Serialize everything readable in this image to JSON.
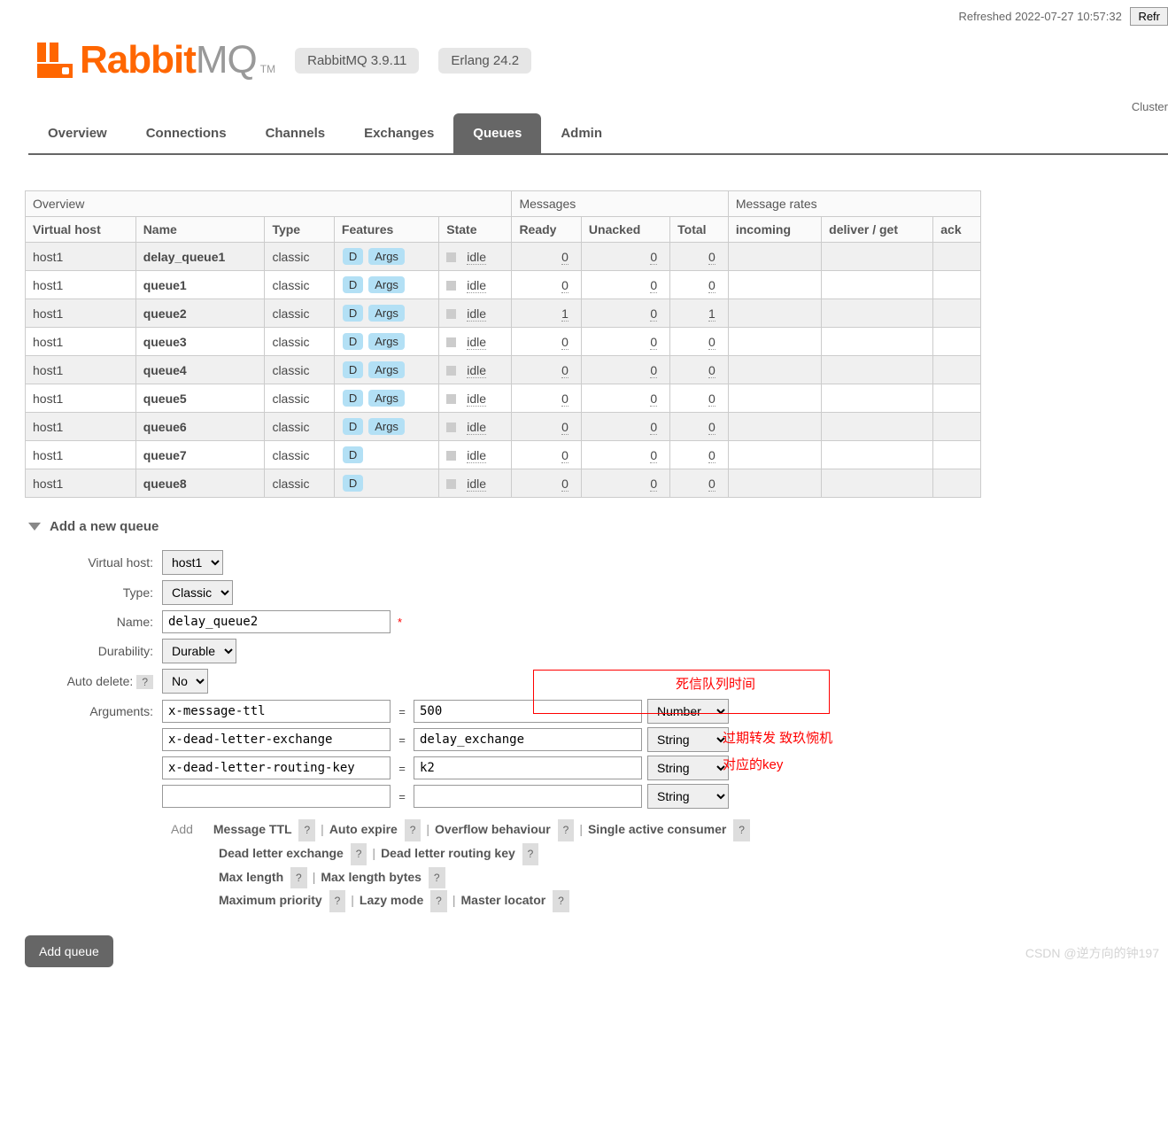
{
  "header": {
    "refreshed": "Refreshed 2022-07-27 10:57:32",
    "refresh_btn": "Refr",
    "cluster_label": "Cluster"
  },
  "logo": {
    "rabbit": "Rabbit",
    "mq": "MQ",
    "tm": "TM"
  },
  "versions": {
    "rabbitmq": "RabbitMQ 3.9.11",
    "erlang": "Erlang 24.2"
  },
  "tabs": [
    "Overview",
    "Connections",
    "Channels",
    "Exchanges",
    "Queues",
    "Admin"
  ],
  "active_tab": "Queues",
  "table": {
    "groups": [
      "Overview",
      "Messages",
      "Message rates"
    ],
    "cols": [
      "Virtual host",
      "Name",
      "Type",
      "Features",
      "State",
      "Ready",
      "Unacked",
      "Total",
      "incoming",
      "deliver / get",
      "ack"
    ],
    "feat_d": "D",
    "feat_args": "Args",
    "rows": [
      {
        "vhost": "host1",
        "name": "delay_queue1",
        "type": "classic",
        "args": true,
        "state": "idle",
        "ready": "0",
        "unacked": "0",
        "total": "0"
      },
      {
        "vhost": "host1",
        "name": "queue1",
        "type": "classic",
        "args": true,
        "state": "idle",
        "ready": "0",
        "unacked": "0",
        "total": "0"
      },
      {
        "vhost": "host1",
        "name": "queue2",
        "type": "classic",
        "args": true,
        "state": "idle",
        "ready": "1",
        "unacked": "0",
        "total": "1"
      },
      {
        "vhost": "host1",
        "name": "queue3",
        "type": "classic",
        "args": true,
        "state": "idle",
        "ready": "0",
        "unacked": "0",
        "total": "0"
      },
      {
        "vhost": "host1",
        "name": "queue4",
        "type": "classic",
        "args": true,
        "state": "idle",
        "ready": "0",
        "unacked": "0",
        "total": "0"
      },
      {
        "vhost": "host1",
        "name": "queue5",
        "type": "classic",
        "args": true,
        "state": "idle",
        "ready": "0",
        "unacked": "0",
        "total": "0"
      },
      {
        "vhost": "host1",
        "name": "queue6",
        "type": "classic",
        "args": true,
        "state": "idle",
        "ready": "0",
        "unacked": "0",
        "total": "0"
      },
      {
        "vhost": "host1",
        "name": "queue7",
        "type": "classic",
        "args": false,
        "state": "idle",
        "ready": "0",
        "unacked": "0",
        "total": "0"
      },
      {
        "vhost": "host1",
        "name": "queue8",
        "type": "classic",
        "args": false,
        "state": "idle",
        "ready": "0",
        "unacked": "0",
        "total": "0"
      }
    ]
  },
  "section": {
    "title": "Add a new queue"
  },
  "form": {
    "vhost_label": "Virtual host:",
    "vhost_value": "host1",
    "type_label": "Type:",
    "type_value": "Classic",
    "name_label": "Name:",
    "name_value": "delay_queue2",
    "durability_label": "Durability:",
    "durability_value": "Durable",
    "autodelete_label": "Auto delete:",
    "autodelete_value": "No",
    "arguments_label": "Arguments:",
    "args": [
      {
        "key": "x-message-ttl",
        "val": "500",
        "type": "Number"
      },
      {
        "key": "x-dead-letter-exchange",
        "val": "delay_exchange",
        "type": "String"
      },
      {
        "key": "x-dead-letter-routing-key",
        "val": "k2",
        "type": "String"
      },
      {
        "key": "",
        "val": "",
        "type": "String"
      }
    ],
    "annotations": {
      "ttl": "死信队列时间",
      "exchange": "过期转发 致玖惋机",
      "key": "对应的key"
    },
    "add_label": "Add",
    "helpers": {
      "line1": [
        "Message TTL",
        "Auto expire",
        "Overflow behaviour",
        "Single active consumer"
      ],
      "line2": [
        "Dead letter exchange",
        "Dead letter routing key"
      ],
      "line3": [
        "Max length",
        "Max length bytes"
      ],
      "line4": [
        "Maximum priority",
        "Lazy mode",
        "Master locator"
      ]
    },
    "submit": "Add queue",
    "q": "?",
    "eq": "="
  },
  "watermark": "CSDN @逆方向的钟197"
}
